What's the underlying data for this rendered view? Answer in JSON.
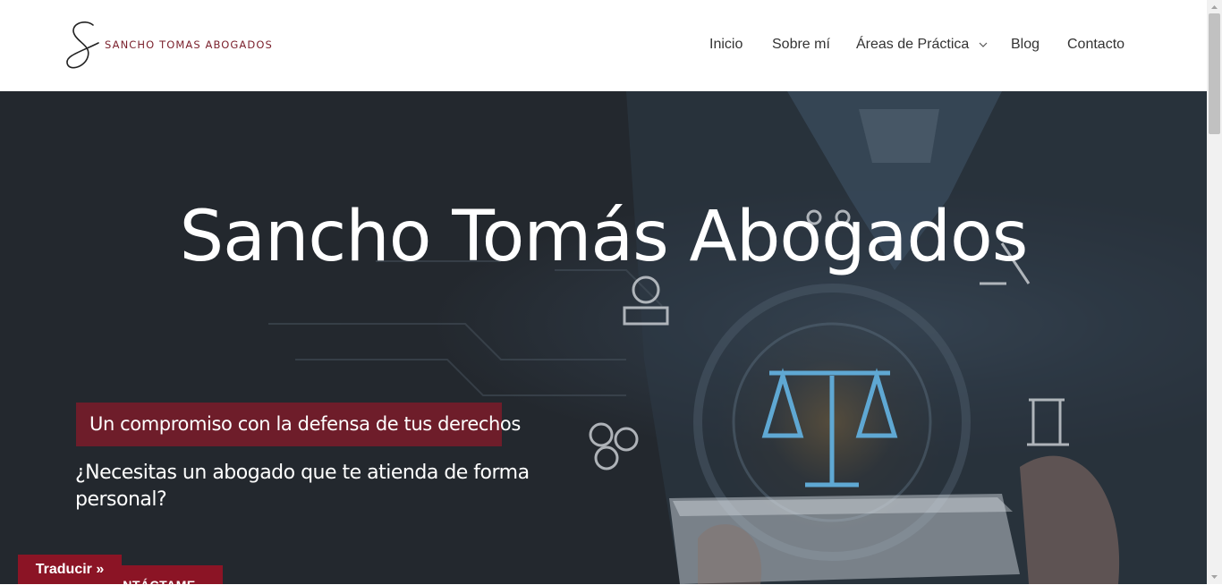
{
  "header": {
    "logo_text": "SANCHO TOMAS ABOGADOS",
    "nav": [
      {
        "label": "Inicio"
      },
      {
        "label": "Sobre mí"
      },
      {
        "label": "Áreas de Práctica"
      },
      {
        "label": "Blog"
      },
      {
        "label": "Contacto"
      }
    ]
  },
  "hero": {
    "title": "Sancho Tomás Abogados",
    "tagline": "Un compromiso con la defensa de tus derechos",
    "question": "¿Necesitas un abogado que te atienda de forma personal?",
    "cta_label": "CONTÁCTAME"
  },
  "translate_label": "Traducir »",
  "colors": {
    "brand": "#6e1d2a",
    "cta": "#8b1425",
    "hero_bg": "#232629",
    "accent_icon": "#5fa8d3"
  }
}
